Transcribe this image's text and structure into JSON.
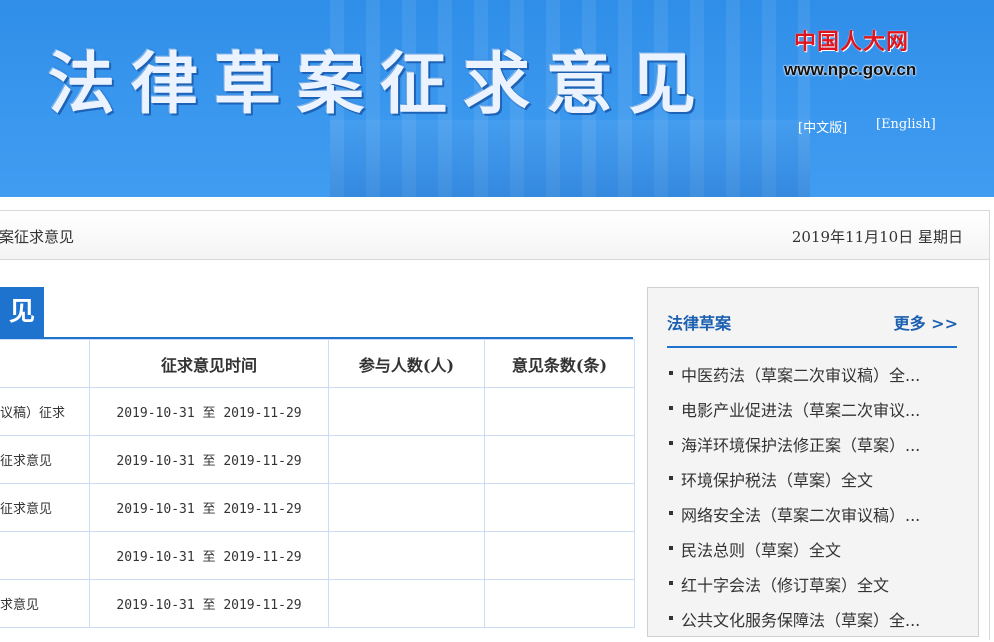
{
  "banner": {
    "title": "法律草案征求意见",
    "logo_cn": "中国人大网",
    "logo_url": "www.npc.gov.cn",
    "lang_cn": "[中文版]",
    "lang_en": "[English]"
  },
  "crumb": {
    "text": "案征求意见",
    "date": "2019年11月10日 星期日"
  },
  "section": {
    "title": "见"
  },
  "table": {
    "headers": [
      "",
      "征求意见时间",
      "参与人数(人)",
      "意见条数(条)"
    ],
    "rows": [
      {
        "name": "议稿）征求",
        "time": "2019-10-31 至 2019-11-29",
        "people": "",
        "count": ""
      },
      {
        "name": "征求意见",
        "time": "2019-10-31 至 2019-11-29",
        "people": "",
        "count": ""
      },
      {
        "name": "征求意见",
        "time": "2019-10-31 至 2019-11-29",
        "people": "",
        "count": ""
      },
      {
        "name": "",
        "time": "2019-10-31 至 2019-11-29",
        "people": "",
        "count": ""
      },
      {
        "name": "求意见",
        "time": "2019-10-31 至 2019-11-29",
        "people": "",
        "count": ""
      }
    ]
  },
  "sidebar": {
    "title": "法律草案",
    "more": "更多 >>",
    "items": [
      "中医药法（草案二次审议稿）全...",
      "电影产业促进法（草案二次审议...",
      "海洋环境保护法修正案（草案）...",
      "环境保护税法（草案）全文",
      "网络安全法（草案二次审议稿）...",
      "民法总则（草案）全文",
      "红十字会法（修订草案）全文",
      "公共文化服务保障法（草案）全..."
    ]
  },
  "colors": {
    "banner": "#3a97ee",
    "accent": "#1e73cf",
    "logo_red": "#e0141e"
  }
}
